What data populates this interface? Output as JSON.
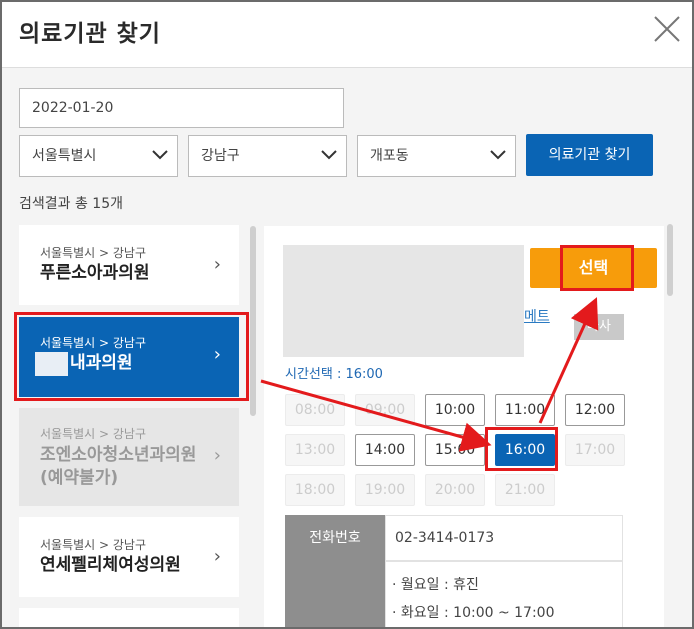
{
  "header": {
    "title": "의료기관 찾기"
  },
  "search": {
    "date": "2022-01-20",
    "city": "서울특별시",
    "district": "강남구",
    "dong": "개포동",
    "find_button": "의료기관 찾기",
    "result_count": "검색결과 총 15개"
  },
  "hospitals": [
    {
      "region": "서울특별시 > 강남구",
      "name": "푸른소아과의원",
      "state": "normal"
    },
    {
      "region": "서울특별시 > 강남구",
      "name": "내과의원",
      "state": "selected"
    },
    {
      "region": "서울특별시 > 강남구",
      "name": "조엔소아청소년과의원",
      "note": "(예약불가)",
      "state": "disabled"
    },
    {
      "region": "서울특별시 > 강남구",
      "name": "연세펠리체여성의원",
      "state": "normal"
    }
  ],
  "detail": {
    "choose_button": "선택",
    "link_text": "메트",
    "tag_text": "나사",
    "time_label": "시간선택 : 16:00",
    "slots": [
      {
        "t": "08:00",
        "s": "off"
      },
      {
        "t": "09:00",
        "s": "off"
      },
      {
        "t": "10:00",
        "s": "avail"
      },
      {
        "t": "11:00",
        "s": "avail"
      },
      {
        "t": "12:00",
        "s": "avail"
      },
      {
        "t": "13:00",
        "s": "off"
      },
      {
        "t": "14:00",
        "s": "avail"
      },
      {
        "t": "15:00",
        "s": "avail"
      },
      {
        "t": "16:00",
        "s": "selected"
      },
      {
        "t": "17:00",
        "s": "off"
      },
      {
        "t": "18:00",
        "s": "off"
      },
      {
        "t": "19:00",
        "s": "off"
      },
      {
        "t": "20:00",
        "s": "off"
      },
      {
        "t": "21:00",
        "s": "off"
      }
    ],
    "phone_label": "전화번호",
    "phone": "02-3414-0173",
    "hours": [
      "· 월요일 : 휴진",
      "· 화요일 : 10:00 ~ 17:00"
    ]
  },
  "colors": {
    "primary": "#0a64b4",
    "accent": "#f79c0b",
    "highlight": "#e31a1c"
  }
}
